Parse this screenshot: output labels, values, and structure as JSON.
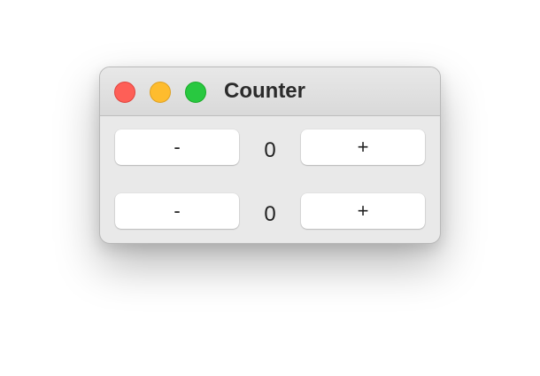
{
  "window": {
    "title": "Counter"
  },
  "traffic_lights": {
    "close_color": "#fe5f57",
    "minimize_color": "#febc2e",
    "zoom_color": "#28c840"
  },
  "counters": [
    {
      "decrement_label": "-",
      "value": "0",
      "increment_label": "+"
    },
    {
      "decrement_label": "-",
      "value": "0",
      "increment_label": "+"
    }
  ]
}
